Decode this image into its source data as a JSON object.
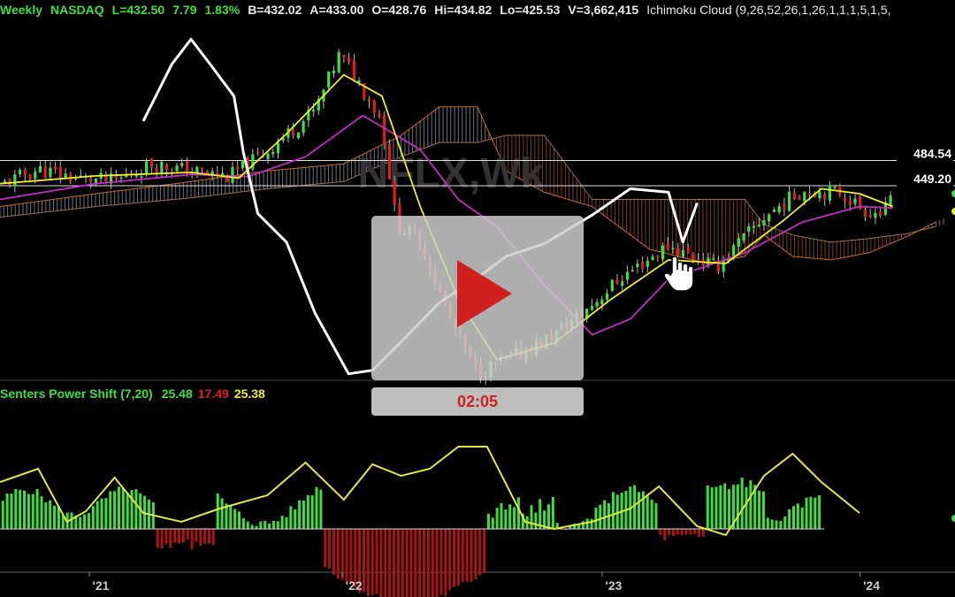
{
  "header": {
    "period": "Weekly",
    "exchange": "NASDAQ",
    "last": "L=432.50",
    "change": "7.79",
    "change_pct": "1.83%",
    "bid": "B=432.02",
    "ask": "A=433.00",
    "open": "O=428.76",
    "high": "Hi=434.82",
    "low": "Lo=425.53",
    "volume": "V=3,662,415",
    "indicator": "Ichimoku Cloud (9,26,52,26,1,26,1,1,1,5,1,5,"
  },
  "watermark": "NFLX,Wk",
  "price_labels": {
    "upper": "484.54",
    "lower": "449.20"
  },
  "indicator2": {
    "name": "Senters Power Shift (7,20)",
    "v1": "25.48",
    "v2": "17.49",
    "v3": "25.38"
  },
  "video": {
    "duration": "02:05"
  },
  "x_labels": [
    "'21",
    "'22",
    "'23",
    "'24"
  ],
  "colors": {
    "up": "#3ee03e",
    "down": "#e01e1e",
    "tenkan": "#f0f020",
    "kijun": "#c828c8",
    "lagging": "#ffffff",
    "cloud_bull": "#d0d0e8",
    "cloud_bear": "#c86a28",
    "osc_up": "#3ee03e",
    "osc_down": "#aa1414",
    "osc_line": "#e6e640"
  },
  "chart_data": {
    "type": "candlestick",
    "price_axis_ticks_shown": [
      484.54,
      449.2
    ],
    "annotated_price_levels": [
      484.54,
      449.2
    ],
    "x_ticks": [
      "'21",
      "'22",
      "'23",
      "'24"
    ],
    "price_close_keypoints": [
      {
        "x": 0.0,
        "y": 450
      },
      {
        "x": 0.04,
        "y": 472
      },
      {
        "x": 0.08,
        "y": 460
      },
      {
        "x": 0.12,
        "y": 455
      },
      {
        "x": 0.16,
        "y": 480
      },
      {
        "x": 0.2,
        "y": 470
      },
      {
        "x": 0.24,
        "y": 462
      },
      {
        "x": 0.28,
        "y": 498
      },
      {
        "x": 0.33,
        "y": 555
      },
      {
        "x": 0.355,
        "y": 632
      },
      {
        "x": 0.37,
        "y": 608
      },
      {
        "x": 0.4,
        "y": 540
      },
      {
        "x": 0.415,
        "y": 395
      },
      {
        "x": 0.44,
        "y": 372
      },
      {
        "x": 0.47,
        "y": 265
      },
      {
        "x": 0.5,
        "y": 185
      },
      {
        "x": 0.53,
        "y": 205
      },
      {
        "x": 0.57,
        "y": 230
      },
      {
        "x": 0.61,
        "y": 270
      },
      {
        "x": 0.65,
        "y": 320
      },
      {
        "x": 0.7,
        "y": 365
      },
      {
        "x": 0.75,
        "y": 335
      },
      {
        "x": 0.8,
        "y": 405
      },
      {
        "x": 0.84,
        "y": 443
      },
      {
        "x": 0.88,
        "y": 440
      },
      {
        "x": 0.905,
        "y": 415
      },
      {
        "x": 0.925,
        "y": 410
      },
      {
        "x": 0.935,
        "y": 432.5
      }
    ],
    "tenkan_keypoints": [
      {
        "x": 0.0,
        "y": 452
      },
      {
        "x": 0.1,
        "y": 463
      },
      {
        "x": 0.2,
        "y": 468
      },
      {
        "x": 0.25,
        "y": 460
      },
      {
        "x": 0.3,
        "y": 522
      },
      {
        "x": 0.36,
        "y": 605
      },
      {
        "x": 0.4,
        "y": 575
      },
      {
        "x": 0.44,
        "y": 420
      },
      {
        "x": 0.48,
        "y": 290
      },
      {
        "x": 0.52,
        "y": 205
      },
      {
        "x": 0.58,
        "y": 228
      },
      {
        "x": 0.64,
        "y": 290
      },
      {
        "x": 0.7,
        "y": 345
      },
      {
        "x": 0.76,
        "y": 340
      },
      {
        "x": 0.82,
        "y": 400
      },
      {
        "x": 0.86,
        "y": 445
      },
      {
        "x": 0.9,
        "y": 438
      },
      {
        "x": 0.935,
        "y": 420
      }
    ],
    "kijun_keypoints": [
      {
        "x": 0.0,
        "y": 430
      },
      {
        "x": 0.1,
        "y": 452
      },
      {
        "x": 0.2,
        "y": 465
      },
      {
        "x": 0.26,
        "y": 462
      },
      {
        "x": 0.32,
        "y": 490
      },
      {
        "x": 0.38,
        "y": 548
      },
      {
        "x": 0.44,
        "y": 500
      },
      {
        "x": 0.48,
        "y": 430
      },
      {
        "x": 0.52,
        "y": 392
      },
      {
        "x": 0.57,
        "y": 310
      },
      {
        "x": 0.62,
        "y": 240
      },
      {
        "x": 0.66,
        "y": 262
      },
      {
        "x": 0.7,
        "y": 318
      },
      {
        "x": 0.78,
        "y": 355
      },
      {
        "x": 0.84,
        "y": 398
      },
      {
        "x": 0.9,
        "y": 420
      },
      {
        "x": 0.935,
        "y": 418
      }
    ],
    "lagging_span_keypoints": [
      {
        "x": 0.15,
        "y": 540
      },
      {
        "x": 0.18,
        "y": 620
      },
      {
        "x": 0.2,
        "y": 655
      },
      {
        "x": 0.22,
        "y": 620
      },
      {
        "x": 0.245,
        "y": 575
      },
      {
        "x": 0.255,
        "y": 495
      },
      {
        "x": 0.27,
        "y": 410
      },
      {
        "x": 0.3,
        "y": 370
      },
      {
        "x": 0.33,
        "y": 270
      },
      {
        "x": 0.365,
        "y": 185
      },
      {
        "x": 0.39,
        "y": 190
      },
      {
        "x": 0.42,
        "y": 230
      },
      {
        "x": 0.46,
        "y": 285
      },
      {
        "x": 0.5,
        "y": 320
      },
      {
        "x": 0.53,
        "y": 350
      },
      {
        "x": 0.57,
        "y": 368
      },
      {
        "x": 0.62,
        "y": 408
      },
      {
        "x": 0.66,
        "y": 445
      },
      {
        "x": 0.7,
        "y": 440
      },
      {
        "x": 0.715,
        "y": 370
      },
      {
        "x": 0.73,
        "y": 425
      }
    ],
    "cloud_keypoints": [
      {
        "x": 0.0,
        "spanA": 420,
        "spanB": 405
      },
      {
        "x": 0.1,
        "spanA": 438,
        "spanB": 420
      },
      {
        "x": 0.2,
        "spanA": 455,
        "spanB": 432
      },
      {
        "x": 0.28,
        "spanA": 470,
        "spanB": 445
      },
      {
        "x": 0.36,
        "spanA": 480,
        "spanB": 455
      },
      {
        "x": 0.42,
        "spanA": 520,
        "spanB": 490
      },
      {
        "x": 0.46,
        "spanA": 560,
        "spanB": 510
      },
      {
        "x": 0.5,
        "spanA": 560,
        "spanB": 510
      },
      {
        "x": 0.53,
        "spanA": 470,
        "spanB": 520
      },
      {
        "x": 0.57,
        "spanA": 440,
        "spanB": 520
      },
      {
        "x": 0.62,
        "spanA": 420,
        "spanB": 430
      },
      {
        "x": 0.68,
        "spanA": 360,
        "spanB": 430
      },
      {
        "x": 0.74,
        "spanA": 340,
        "spanB": 430
      },
      {
        "x": 0.78,
        "spanA": 350,
        "spanB": 430
      },
      {
        "x": 0.8,
        "spanA": 380,
        "spanB": 395
      },
      {
        "x": 0.83,
        "spanA": 350,
        "spanB": 380
      },
      {
        "x": 0.87,
        "spanA": 345,
        "spanB": 370
      },
      {
        "x": 0.91,
        "spanA": 355,
        "spanB": 375
      },
      {
        "x": 0.95,
        "spanA": 378,
        "spanB": 382
      },
      {
        "x": 0.99,
        "spanA": 405,
        "spanB": 395
      }
    ]
  }
}
